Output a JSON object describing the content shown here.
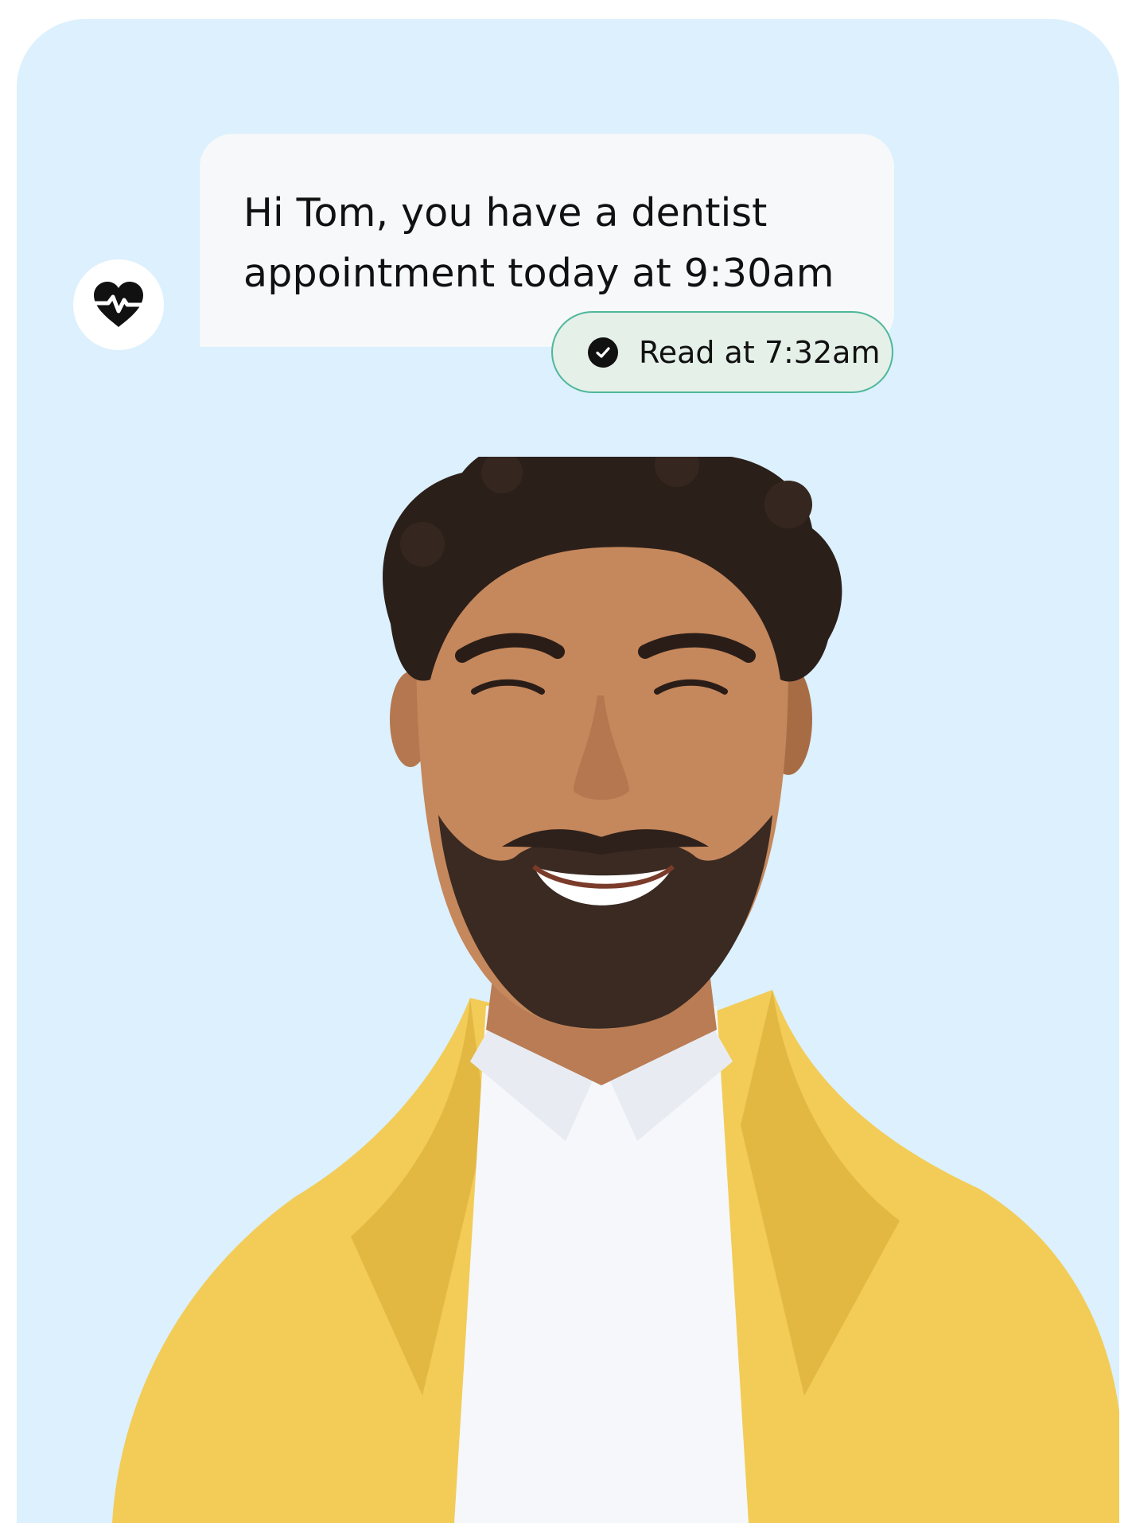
{
  "message": {
    "text": "Hi Tom, you have a dentist appointment today at 9:30am",
    "read_status": "Read at 7:32am"
  },
  "icons": {
    "sender": "heart-pulse-icon",
    "read": "check-circle-icon"
  },
  "colors": {
    "background": "#dcf0fd",
    "bubble": "#f6f8fa",
    "read_pill_fill": "#e4f0e8",
    "read_pill_border": "#4fb79a",
    "jacket": "#f2cc57"
  }
}
